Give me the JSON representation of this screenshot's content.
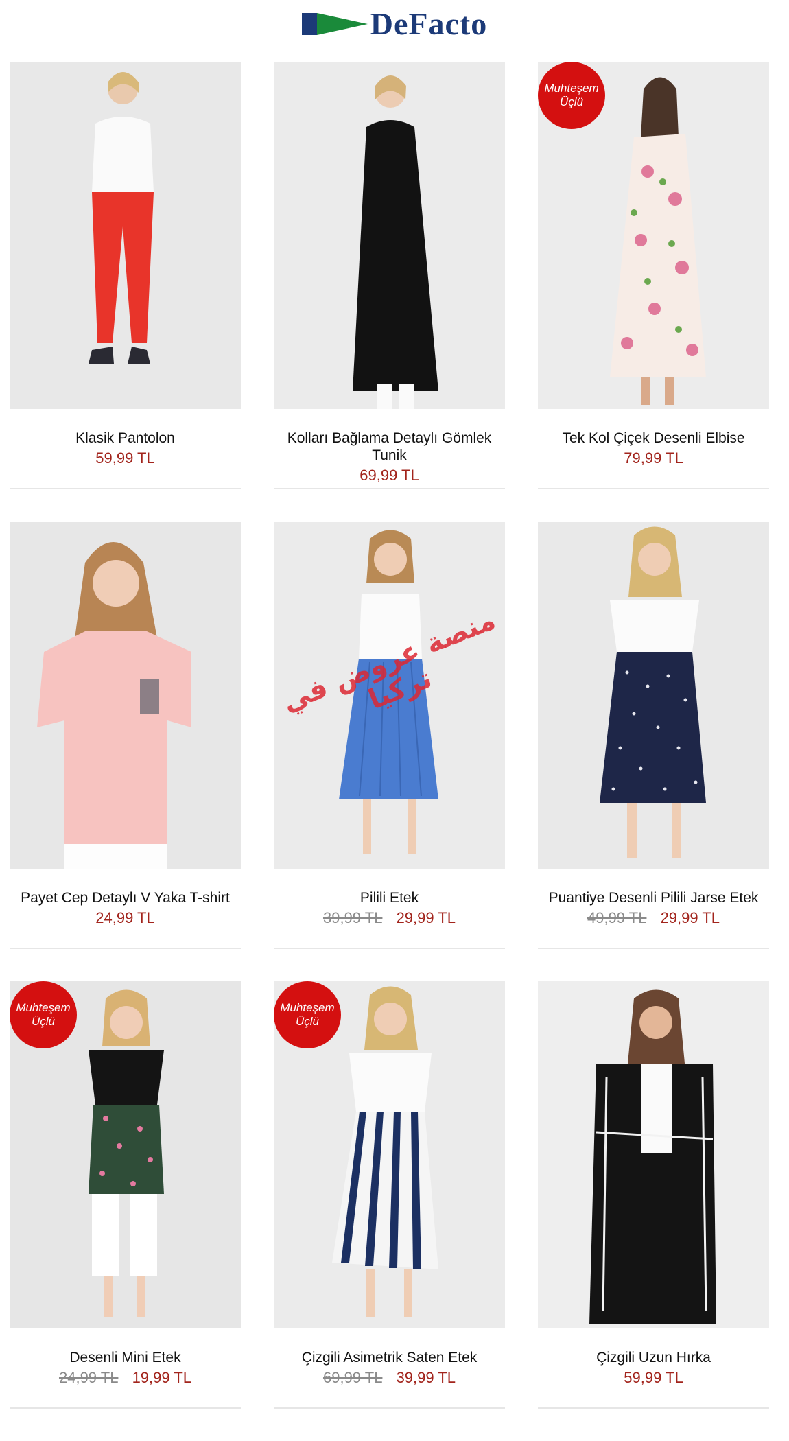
{
  "brand": {
    "name": "DeFacto",
    "colors": {
      "navy": "#1c3a78",
      "green": "#1a8a3a"
    }
  },
  "colors": {
    "price": "#a2241c",
    "old_price": "#8a8a8a",
    "badge": "#d41010",
    "watermark": "#dc2832"
  },
  "products": [
    {
      "name": "Klasik Pantolon",
      "old_price": "",
      "price": "59,99 TL",
      "badge": ""
    },
    {
      "name": "Kolları Bağlama Detaylı Gömlek Tunik",
      "old_price": "",
      "price": "69,99 TL",
      "badge": ""
    },
    {
      "name": "Tek Kol Çiçek Desenli Elbise",
      "old_price": "",
      "price": "79,99 TL",
      "badge": "Muhteşem Üçlü"
    },
    {
      "name": "Payet Cep Detaylı V Yaka T-shirt",
      "old_price": "",
      "price": "24,99 TL",
      "badge": ""
    },
    {
      "name": "Pilili Etek",
      "old_price": "39,99 TL",
      "price": "29,99 TL",
      "badge": ""
    },
    {
      "name": "Puantiye Desenli Pilili Jarse Etek",
      "old_price": "49,99 TL",
      "price": "29,99 TL",
      "badge": ""
    },
    {
      "name": "Desenli Mini Etek",
      "old_price": "24,99 TL",
      "price": "19,99 TL",
      "badge": "Muhteşem Üçlü"
    },
    {
      "name": "Çizgili Asimetrik Saten Etek",
      "old_price": "69,99 TL",
      "price": "39,99 TL",
      "badge": "Muhteşem Üçlü"
    },
    {
      "name": "Çizgili Uzun Hırka",
      "old_price": "",
      "price": "59,99 TL",
      "badge": ""
    }
  ],
  "badge_lines": [
    "Muhteşem",
    "Üçlü"
  ],
  "watermark": "منصة عروض في تركيا"
}
